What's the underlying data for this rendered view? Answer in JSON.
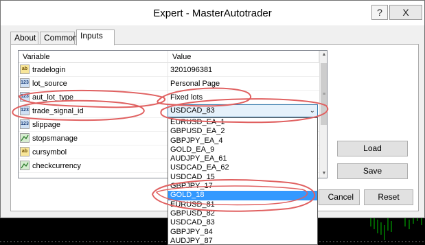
{
  "window": {
    "title": "Expert - MasterAutotrader",
    "help_label": "?",
    "close_label": "X"
  },
  "tabs": [
    {
      "label": "About"
    },
    {
      "label": "Common"
    },
    {
      "label": "Inputs"
    }
  ],
  "grid": {
    "headers": {
      "variable": "Variable",
      "value": "Value"
    },
    "rows": [
      {
        "icon": "ab",
        "name": "tradelogin",
        "value": "3201096381"
      },
      {
        "icon": "123",
        "name": "lot_source",
        "value": "Personal Page"
      },
      {
        "icon": "123",
        "name": "aut_lot_type",
        "value": "Fixed lots"
      },
      {
        "icon": "123",
        "name": "trade_signal_id",
        "value": "USDCAD_83"
      },
      {
        "icon": "123",
        "name": "slippage",
        "value": ""
      },
      {
        "icon": "double",
        "name": "stopsmanage",
        "value": ""
      },
      {
        "icon": "ab",
        "name": "cursymbol",
        "value": ""
      },
      {
        "icon": "double",
        "name": "checkcurrency",
        "value": ""
      }
    ]
  },
  "combo": {
    "value": "USDCAD_83",
    "arrow": "⌄"
  },
  "dropdown": {
    "items": [
      "EURUSD_EA_1",
      "GBPUSD_EA_2",
      "GBPJPY_EA_4",
      "GOLD_EA_9",
      "AUDJPY_EA_61",
      "USDCAD_EA_62",
      "USDCAD_15",
      "GBPJPY_17",
      "GOLD_18",
      "EURUSD_81",
      "GBPUSD_82",
      "USDCAD_83",
      "GBPJPY_84",
      "AUDJPY_87"
    ],
    "selected_index": 8
  },
  "buttons": {
    "load": "Load",
    "save": "Save",
    "cancel": "Cancel",
    "reset": "Reset"
  },
  "colors": {
    "selection": "#3399ff",
    "annotation": "#e06060",
    "combo_border": "#3c7fb1"
  }
}
